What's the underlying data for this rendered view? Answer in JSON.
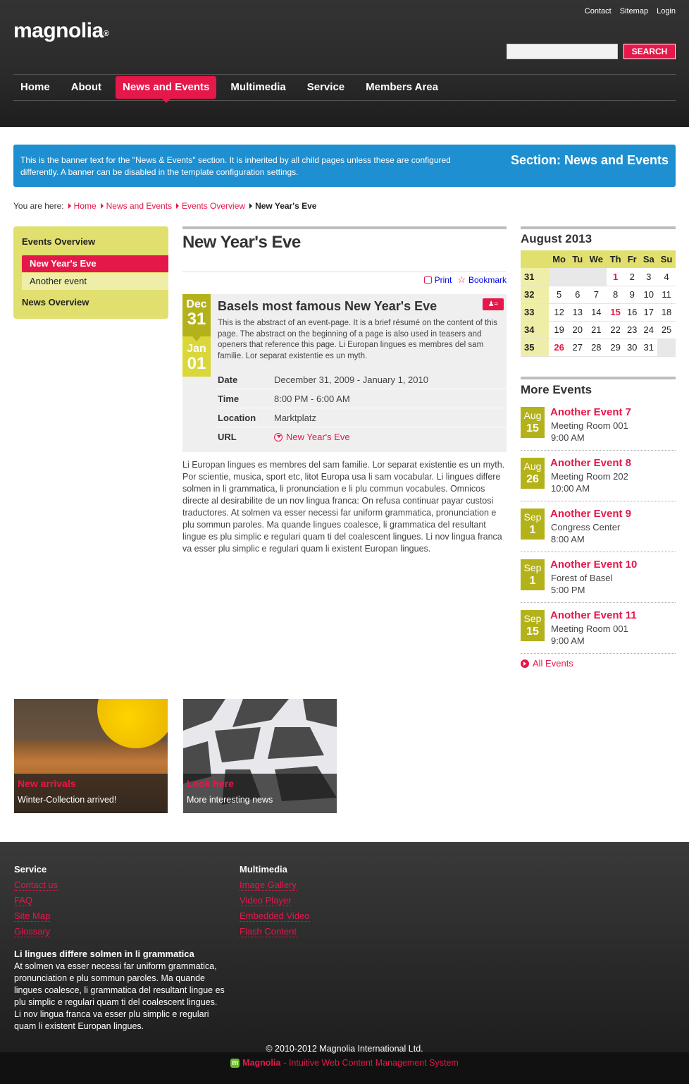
{
  "header": {
    "logo": "magnolia",
    "logo_mark": "®",
    "utility_links": [
      "Contact",
      "Sitemap",
      "Login"
    ],
    "search_placeholder": "",
    "search_button": "SEARCH",
    "nav": [
      "Home",
      "About",
      "News and Events",
      "Multimedia",
      "Service",
      "Members Area"
    ],
    "nav_active_index": 2
  },
  "banner": {
    "text": "This is the banner text for the \"News & Events\" section. It is inherited by all child pages unless these are configured differently. A banner can be disabled in the template configuration settings.",
    "section": "Section: News and Events"
  },
  "breadcrumb": {
    "prefix": "You are here:",
    "items": [
      "Home",
      "News and Events",
      "Events Overview"
    ],
    "current": "New Year's Eve"
  },
  "left_nav": {
    "heading": "Events Overview",
    "items": [
      "New Year's Eve",
      "Another event"
    ],
    "active_index": 0,
    "heading2": "News Overview"
  },
  "main": {
    "title": "New Year's Eve",
    "tools": [
      "Print",
      "Bookmark"
    ],
    "event": {
      "start_month": "Dec",
      "start_day": "31",
      "end_month": "Jan",
      "end_day": "01",
      "title": "Basels most famous New Year's Eve",
      "abstract": "This is the abstract of an event-page. It is a brief résumé on the content of this page. The abstract on the beginning of a page is also used in teasers and openers that reference this page. Li Europan lingues es membres del sam familie. Lor separat existentie es un myth.",
      "details": [
        {
          "label": "Date",
          "value": "December 31, 2009 - January 1, 2010"
        },
        {
          "label": "Time",
          "value": "8:00 PM - 6:00 AM"
        },
        {
          "label": "Location",
          "value": "Marktplatz"
        },
        {
          "label": "URL",
          "value": "New Year's Eve"
        }
      ]
    },
    "body": "Li Europan lingues es membres del sam familie. Lor separat existentie es un myth. Por scientie, musica, sport etc, litot Europa usa li sam vocabular. Li lingues differe solmen in li grammatica, li pronunciation e li plu commun vocabules. Omnicos directe al desirabilite de un nov lingua franca: On refusa continuar payar custosi traductores. At solmen va esser necessi far uniform grammatica, pronunciation e plu sommun paroles. Ma quande lingues coalesce, li grammatica del resultant lingue es plu simplic e regulari quam ti del coalescent lingues. Li nov lingua franca va esser plu simplic e regulari quam li existent Europan lingues."
  },
  "calendar": {
    "title": "August 2013",
    "weekdays": [
      "Mo",
      "Tu",
      "We",
      "Th",
      "Fr",
      "Sa",
      "Su"
    ],
    "weeks": [
      {
        "wk": "31",
        "days": [
          "",
          "",
          "",
          "1",
          "2",
          "3",
          "4"
        ]
      },
      {
        "wk": "32",
        "days": [
          "5",
          "6",
          "7",
          "8",
          "9",
          "10",
          "11"
        ]
      },
      {
        "wk": "33",
        "days": [
          "12",
          "13",
          "14",
          "15",
          "16",
          "17",
          "18"
        ]
      },
      {
        "wk": "34",
        "days": [
          "19",
          "20",
          "21",
          "22",
          "23",
          "24",
          "25"
        ]
      },
      {
        "wk": "35",
        "days": [
          "26",
          "27",
          "28",
          "29",
          "30",
          "31",
          ""
        ]
      }
    ],
    "event_days": [
      "1",
      "15",
      "26"
    ]
  },
  "more_events": {
    "title": "More Events",
    "items": [
      {
        "month": "Aug",
        "day": "15",
        "title": "Another Event 7",
        "location": "Meeting Room 001",
        "time": "9:00 AM"
      },
      {
        "month": "Aug",
        "day": "26",
        "title": "Another Event 8",
        "location": "Meeting Room 202",
        "time": "10:00 AM"
      },
      {
        "month": "Sep",
        "day": "1",
        "title": "Another Event 9",
        "location": "Congress Center",
        "time": "8:00 AM"
      },
      {
        "month": "Sep",
        "day": "1",
        "title": "Another Event 10",
        "location": "Forest of Basel",
        "time": "5:00 PM"
      },
      {
        "month": "Sep",
        "day": "15",
        "title": "Another Event 11",
        "location": "Meeting Room 001",
        "time": "9:00 AM"
      }
    ],
    "all_link": "All Events"
  },
  "teasers": [
    {
      "title": "New arrivals",
      "subtitle": "Winter-Collection arrived!"
    },
    {
      "title": "Look here",
      "subtitle": "More interesting news"
    }
  ],
  "footer": {
    "col1_head": "Service",
    "col1_links": [
      "Contact us",
      "FAQ",
      "Site Map",
      "Glossary"
    ],
    "col2_head": "Multimedia",
    "col2_links": [
      "Image Gallery",
      "Video Player",
      "Embedded Video",
      "Flash Content"
    ],
    "text_head": "Li lingues differe solmen in li grammatica",
    "text": "At solmen va esser necessi far uniform grammatica, pronunciation e plu sommun paroles. Ma quande lingues coalesce, li grammatica del resultant lingue es plu simplic e regulari quam ti del coalescent lingues. Li nov lingua franca va esser plu simplic e regulari quam li existent Europan lingues.",
    "copyright": "© 2010-2012 Magnolia International Ltd.",
    "powered_brand": "Magnolia",
    "powered_text": "- Intuitive Web Content Management System"
  },
  "colors": {
    "accent": "#e5184a",
    "olive": "#b4b21b",
    "yellow": "#e1e06f",
    "banner_blue": "#1e8fd0"
  }
}
